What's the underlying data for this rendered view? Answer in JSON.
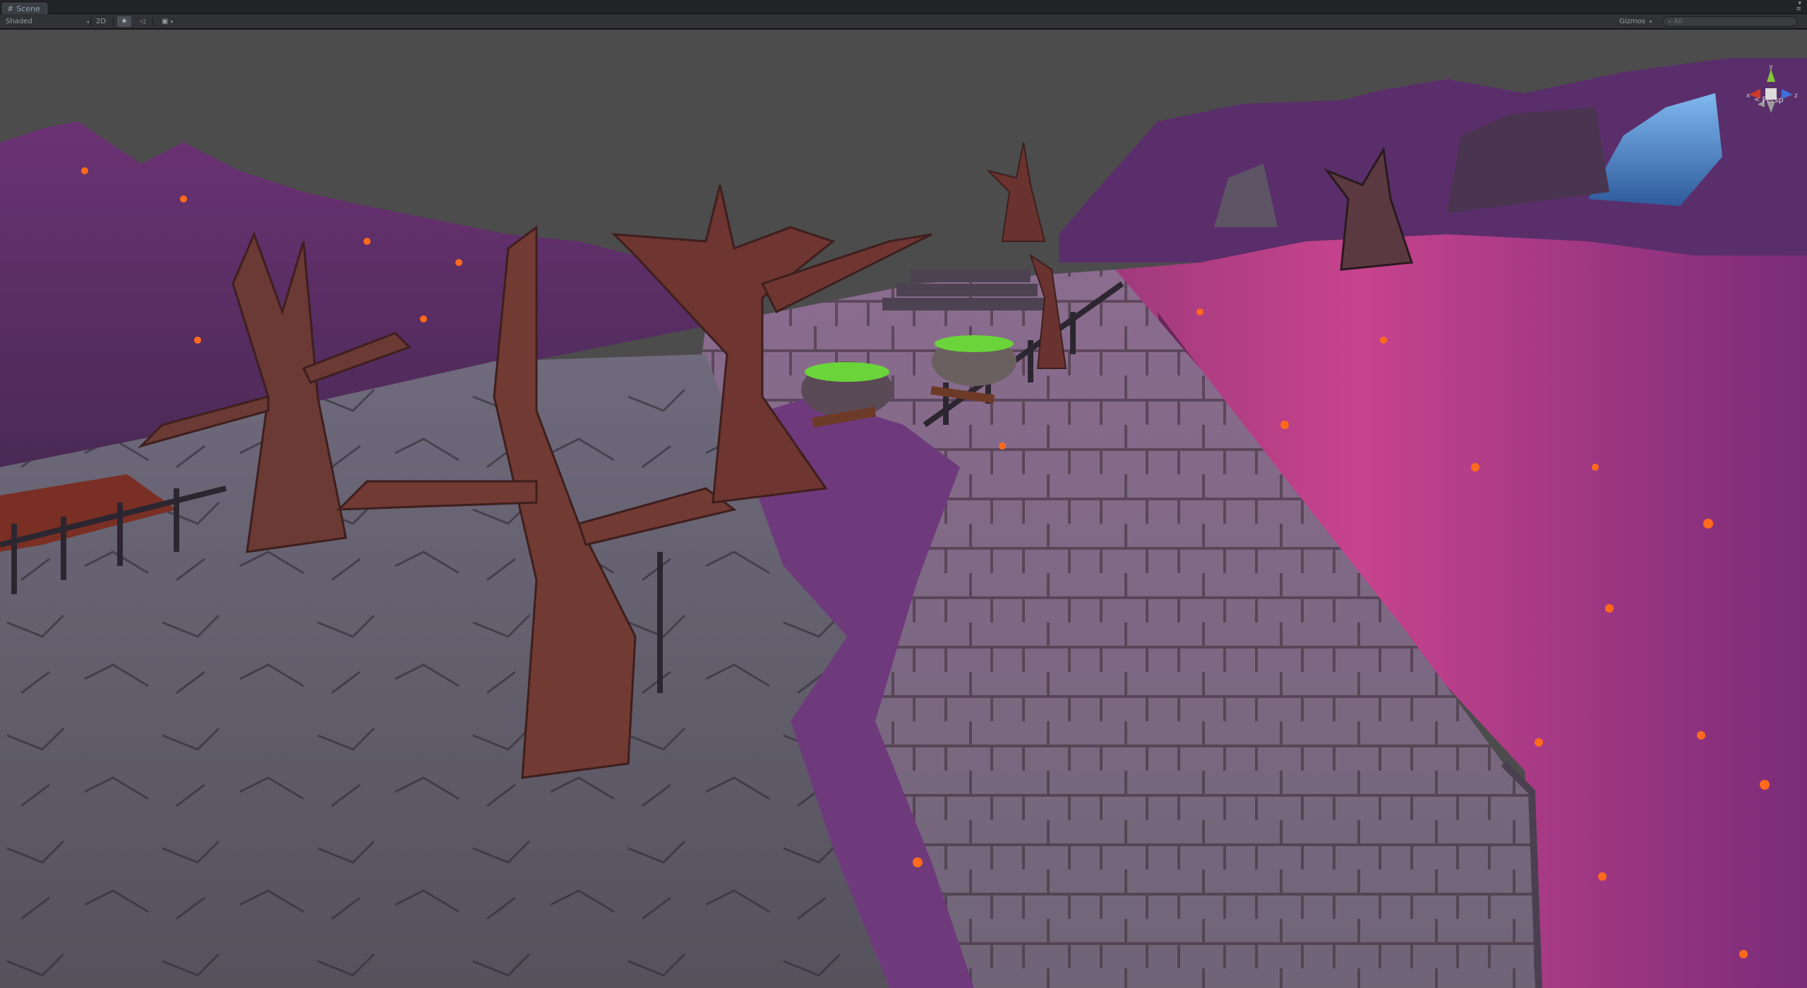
{
  "window": {
    "tab_label": "Scene",
    "tab_icon": "scene-icon"
  },
  "toolbar": {
    "draw_mode": "Shaded",
    "mode_2d": "2D",
    "scene_lighting_icon": "sun-icon",
    "scene_audio_icon": "speaker-icon",
    "effects_icon": "image-icon",
    "gizmos_label": "Gizmos",
    "search_placeholder": "All"
  },
  "gizmo": {
    "axis_y": "y",
    "axis_x": "x",
    "axis_z": "z",
    "projection_label": "Persp",
    "colors": {
      "x": "#d03a2a",
      "y": "#86c63c",
      "z": "#3e6fd8",
      "center": "#dcdcdc"
    }
  },
  "scene": {
    "description_icon": "fantasy-graveyard-scene",
    "sky_color": "#4c4c4c",
    "terrain_color": "#7a3a85",
    "path_color": "#7d6780",
    "ember_color": "#ff6a1c",
    "cauldron_liquid_color": "#6bd43a"
  }
}
